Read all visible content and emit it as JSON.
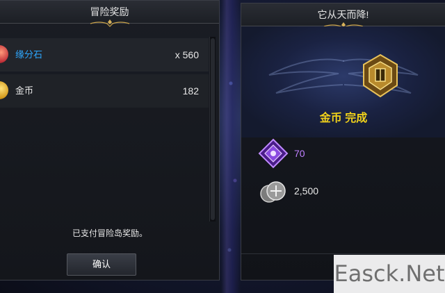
{
  "left_panel": {
    "title": "冒险奖励",
    "items": [
      {
        "name": "缘分石",
        "quantity": "x 560",
        "name_color": "#2ea8ff"
      },
      {
        "name": "金币",
        "quantity": "182",
        "name_color": "#e8e8e8"
      }
    ],
    "message": "已支付冒险岛奖励。",
    "confirm_label": "确认"
  },
  "right_panel": {
    "title": "它从天而降!",
    "banner_text": "金币 完成",
    "rewards": [
      {
        "icon": "purple-gem-icon",
        "value": "70",
        "color": "#c080ff"
      },
      {
        "icon": "coin-stack-icon",
        "value": "2,500",
        "color": "#e8e8e8"
      }
    ]
  },
  "watermark": "Easck.Net",
  "colors": {
    "accent_gold": "#f2d21a",
    "accent_blue": "#2ea8ff",
    "accent_purple": "#c080ff"
  }
}
